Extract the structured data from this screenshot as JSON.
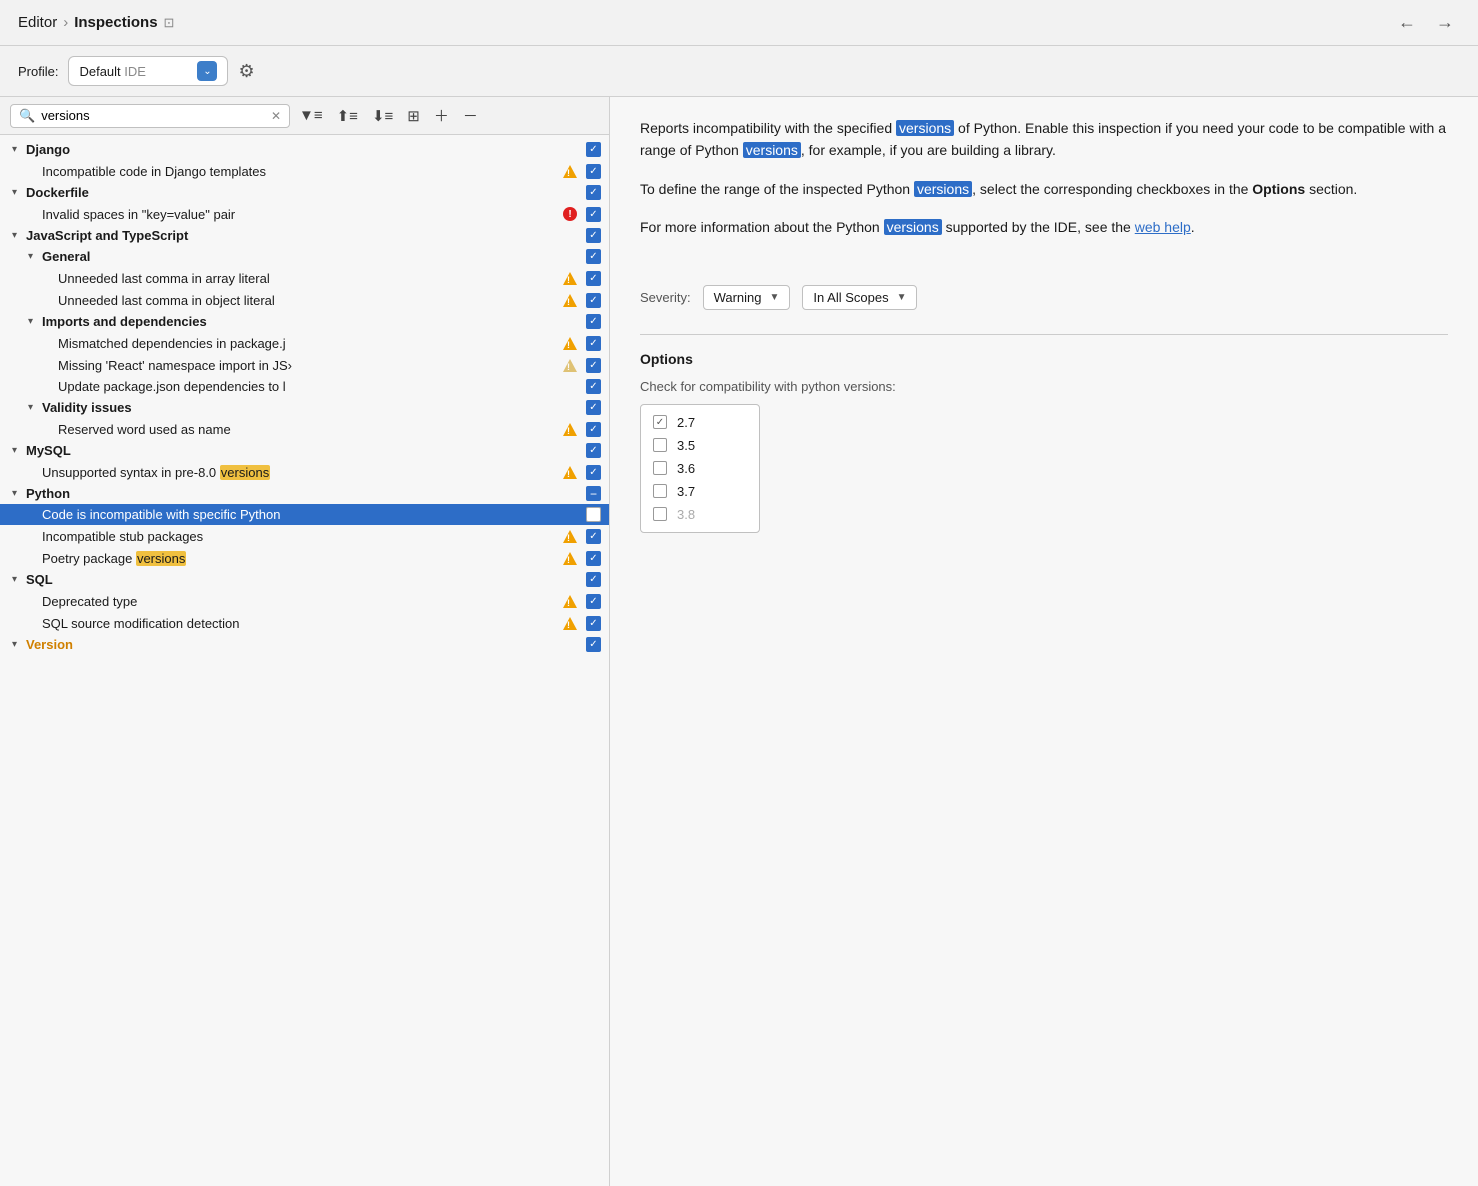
{
  "header": {
    "breadcrumb_editor": "Editor",
    "breadcrumb_separator": "›",
    "breadcrumb_current": "Inspections",
    "back_arrow": "←",
    "forward_arrow": "→"
  },
  "profile": {
    "label": "Profile:",
    "name": "Default",
    "ide": "IDE",
    "gear_icon": "⚙"
  },
  "toolbar": {
    "search_value": "versions",
    "filter_icon": "▼",
    "expand_all": "≡",
    "collapse_all": "≡",
    "group_icon": "⊞",
    "add_icon": "+",
    "remove_icon": "−"
  },
  "tree": {
    "items": [
      {
        "id": "django",
        "label": "Django",
        "bold": true,
        "indent": 0,
        "expand": true,
        "checkbox": "checked",
        "warning": null
      },
      {
        "id": "django-incompatible",
        "label": "Incompatible code in Django templates",
        "bold": false,
        "indent": 1,
        "expand": false,
        "checkbox": "checked",
        "warning": "warning"
      },
      {
        "id": "dockerfile",
        "label": "Dockerfile",
        "bold": true,
        "indent": 0,
        "expand": true,
        "checkbox": "checked",
        "warning": null
      },
      {
        "id": "dockerfile-invalid",
        "label": "Invalid spaces in \"key=value\" pair",
        "bold": false,
        "indent": 1,
        "expand": false,
        "checkbox": "checked",
        "warning": "error"
      },
      {
        "id": "js-ts",
        "label": "JavaScript and TypeScript",
        "bold": true,
        "indent": 0,
        "expand": true,
        "checkbox": "checked",
        "warning": null
      },
      {
        "id": "general",
        "label": "General",
        "bold": true,
        "indent": 1,
        "expand": true,
        "checkbox": "checked",
        "warning": null
      },
      {
        "id": "unneeded-array",
        "label": "Unneeded last comma in array literal",
        "bold": false,
        "indent": 2,
        "expand": false,
        "checkbox": "checked",
        "warning": "warning"
      },
      {
        "id": "unneeded-object",
        "label": "Unneeded last comma in object literal",
        "bold": false,
        "indent": 2,
        "expand": false,
        "checkbox": "checked",
        "warning": "warning"
      },
      {
        "id": "imports-deps",
        "label": "Imports and dependencies",
        "bold": true,
        "indent": 1,
        "expand": true,
        "checkbox": "checked",
        "warning": null
      },
      {
        "id": "mismatched",
        "label": "Mismatched dependencies in package.j",
        "bold": false,
        "indent": 2,
        "expand": false,
        "checkbox": "checked",
        "warning": "warning"
      },
      {
        "id": "missing-react",
        "label": "Missing 'React' namespace import in JS›",
        "bold": false,
        "indent": 2,
        "expand": false,
        "checkbox": "checked",
        "warning": "warning-faded"
      },
      {
        "id": "update-package",
        "label": "Update package.json dependencies to l",
        "bold": false,
        "indent": 2,
        "expand": false,
        "checkbox": "checked",
        "warning": null
      },
      {
        "id": "validity",
        "label": "Validity issues",
        "bold": true,
        "indent": 1,
        "expand": true,
        "checkbox": "checked",
        "warning": null
      },
      {
        "id": "reserved-word",
        "label": "Reserved word used as name",
        "bold": false,
        "indent": 2,
        "expand": false,
        "checkbox": "checked",
        "warning": "warning"
      },
      {
        "id": "mysql",
        "label": "MySQL",
        "bold": true,
        "indent": 0,
        "expand": true,
        "checkbox": "checked",
        "warning": null
      },
      {
        "id": "unsupported",
        "label": "Unsupported syntax in pre-8.0 versions",
        "bold": false,
        "indent": 1,
        "expand": false,
        "checkbox": "checked",
        "warning": "warning",
        "highlight": "versions"
      },
      {
        "id": "python",
        "label": "Python",
        "bold": true,
        "indent": 0,
        "expand": true,
        "checkbox": "minus",
        "warning": null
      },
      {
        "id": "code-incompatible",
        "label": "Code is incompatible with specific Python",
        "bold": false,
        "indent": 1,
        "expand": false,
        "checkbox": "unchecked-white",
        "warning": null,
        "selected": true
      },
      {
        "id": "incompatible-stub",
        "label": "Incompatible stub packages",
        "bold": false,
        "indent": 1,
        "expand": false,
        "checkbox": "checked",
        "warning": "warning"
      },
      {
        "id": "poetry",
        "label": "Poetry package versions",
        "bold": false,
        "indent": 1,
        "expand": false,
        "checkbox": "checked",
        "warning": "warning",
        "highlight": "versions"
      },
      {
        "id": "sql",
        "label": "SQL",
        "bold": true,
        "indent": 0,
        "expand": true,
        "checkbox": "checked",
        "warning": null
      },
      {
        "id": "deprecated-type",
        "label": "Deprecated type",
        "bold": false,
        "indent": 1,
        "expand": false,
        "checkbox": "checked",
        "warning": "warning"
      },
      {
        "id": "sql-source",
        "label": "SQL source modification detection",
        "bold": false,
        "indent": 1,
        "expand": false,
        "checkbox": "checked",
        "warning": "warning"
      },
      {
        "id": "version-section",
        "label": "Version",
        "bold": true,
        "indent": 0,
        "expand": false,
        "checkbox": "checked",
        "warning": null,
        "partial": true
      }
    ]
  },
  "description": {
    "paragraphs": [
      "Reports incompatibility with the specified versions of Python. Enable this inspection if you need your code to be compatible with a range of Python versions, for example, if you are building a library.",
      "To define the range of the inspected Python versions, select the corresponding checkboxes in the Options section.",
      "For more information about the Python versions supported by the IDE, see the web help."
    ],
    "highlights": [
      "versions",
      "versions",
      "versions",
      "versions"
    ],
    "web_help_text": "web help"
  },
  "severity": {
    "label": "Severity:",
    "value": "Warning",
    "scope_value": "In All Scopes"
  },
  "options": {
    "title": "Options",
    "subtitle": "Check for compatibility with python versions:",
    "versions": [
      {
        "version": "2.7",
        "checked": true
      },
      {
        "version": "3.5",
        "checked": false
      },
      {
        "version": "3.6",
        "checked": false
      },
      {
        "version": "3.7",
        "checked": false
      },
      {
        "version": "3.8",
        "partial": true
      }
    ]
  }
}
